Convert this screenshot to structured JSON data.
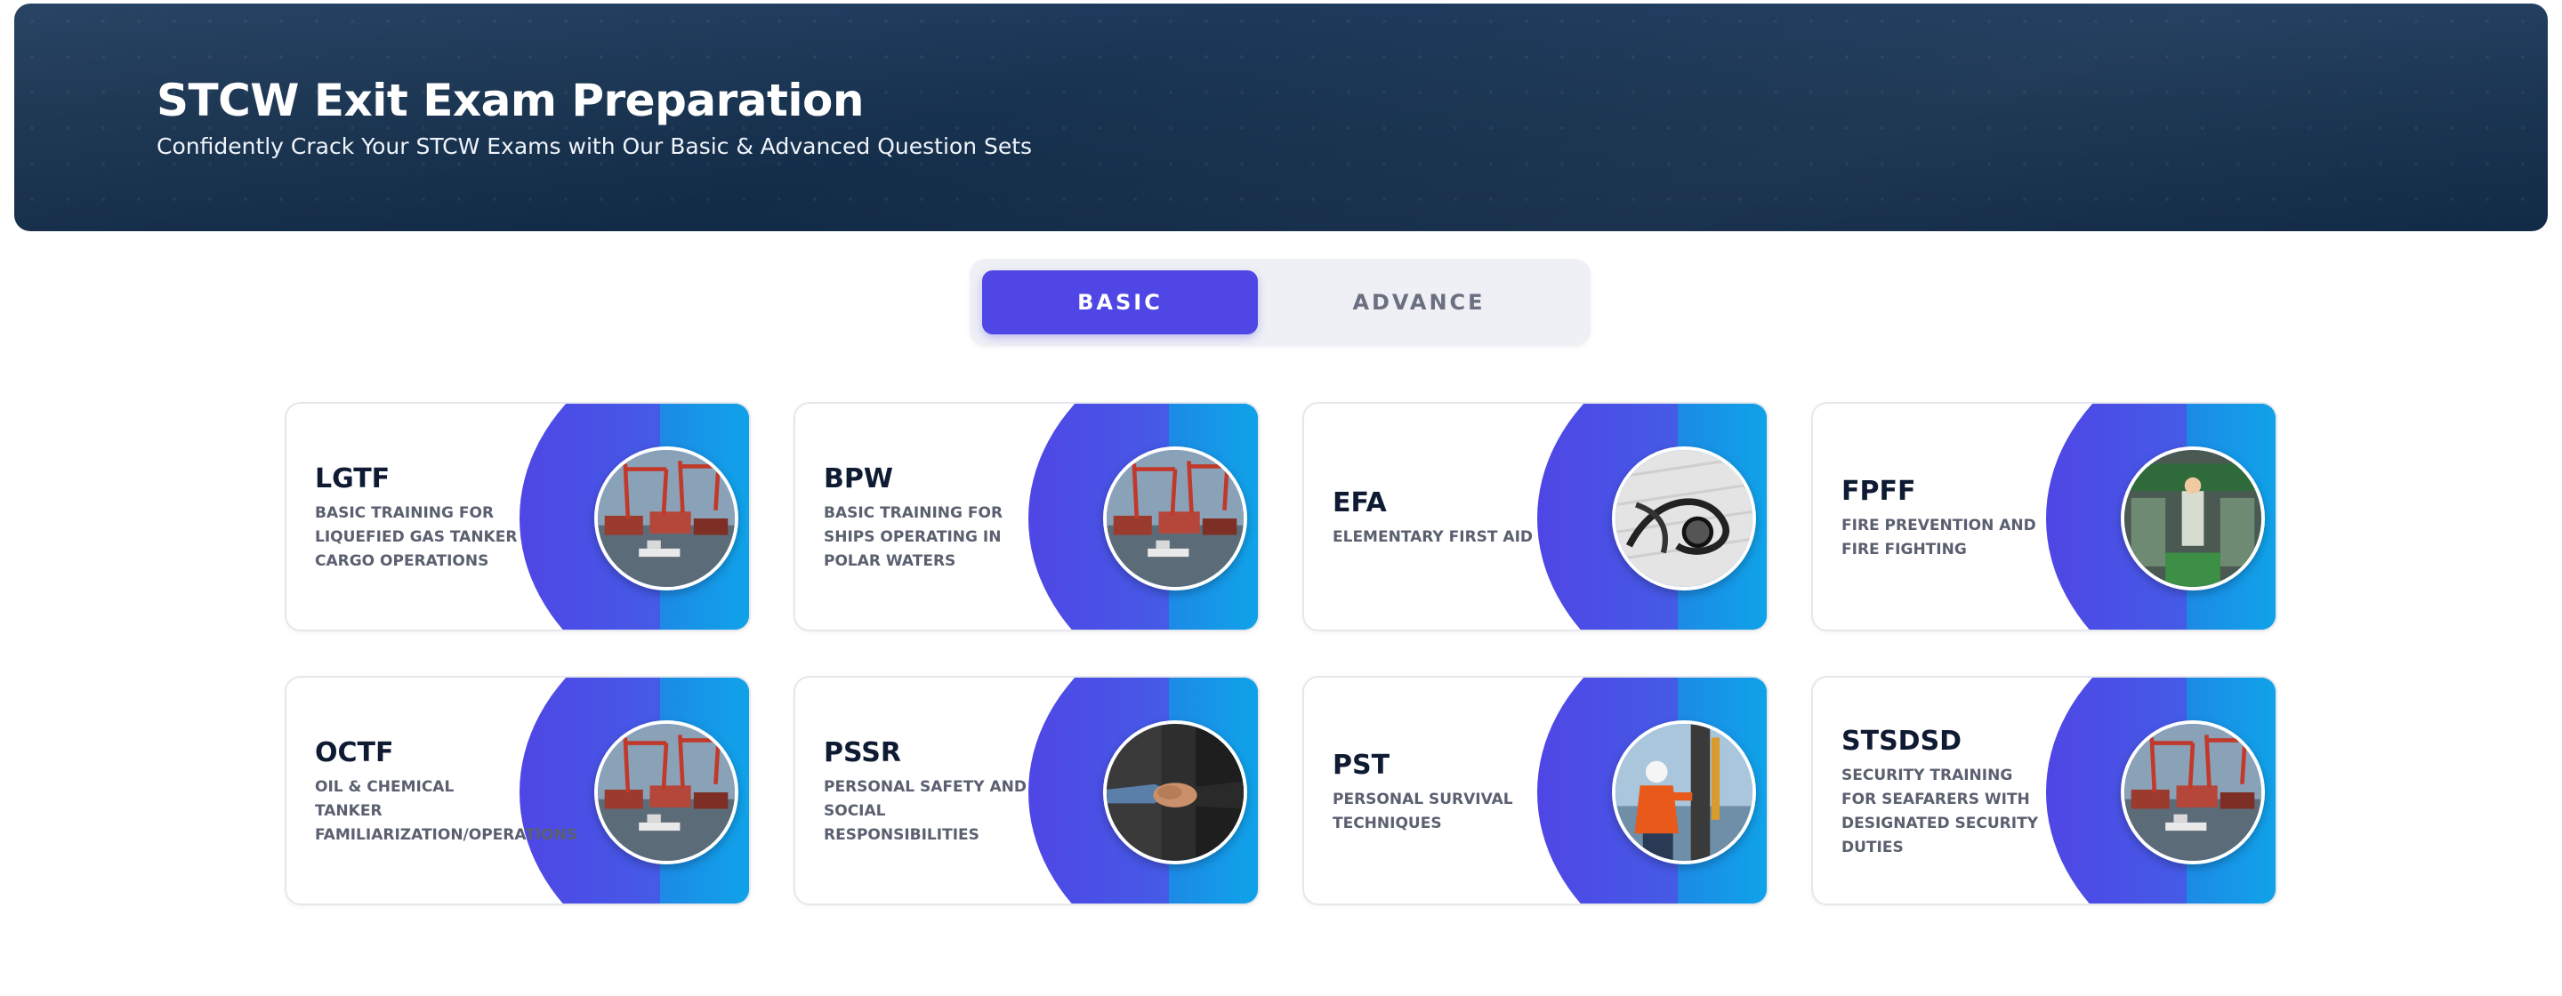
{
  "hero": {
    "title": "STCW Exit Exam Preparation",
    "subtitle": "Confidently Crack Your STCW Exams with Our Basic & Advanced Question Sets"
  },
  "tabs": [
    {
      "label": "BASIC",
      "active": true
    },
    {
      "label": "ADVANCE",
      "active": false
    }
  ],
  "colors": {
    "accent": "#4f46e5",
    "gradient_end": "#0ea5e9",
    "hero_bg": "#17324f"
  },
  "courses": [
    {
      "code": "LGTF",
      "description": "BASIC TRAINING FOR LIQUEFIED GAS TANKER CARGO OPERATIONS",
      "image": "port-cranes-image"
    },
    {
      "code": "BPW",
      "description": "BASIC TRAINING FOR SHIPS OPERATING IN POLAR WATERS",
      "image": "port-cranes-image"
    },
    {
      "code": "EFA",
      "description": "ELEMENTARY FIRST AID",
      "image": "stethoscope-image"
    },
    {
      "code": "FPFF",
      "description": "FIRE PREVENTION AND FIRE FIGHTING",
      "image": "engine-room-image"
    },
    {
      "code": "OCTF",
      "description": "OIL & CHEMICAL TANKER FAMILIARIZATION/OPERATIONS",
      "image": "port-cranes-image"
    },
    {
      "code": "PSSR",
      "description": "PERSONAL SAFETY AND SOCIAL RESPONSIBILITIES",
      "image": "handshake-image"
    },
    {
      "code": "PST",
      "description": "PERSONAL SURVIVAL TECHNIQUES",
      "image": "seafarer-image"
    },
    {
      "code": "STSDSD",
      "description": "SECURITY TRAINING FOR SEAFARERS WITH DESIGNATED SECURITY DUTIES",
      "image": "port-cranes-image"
    }
  ]
}
